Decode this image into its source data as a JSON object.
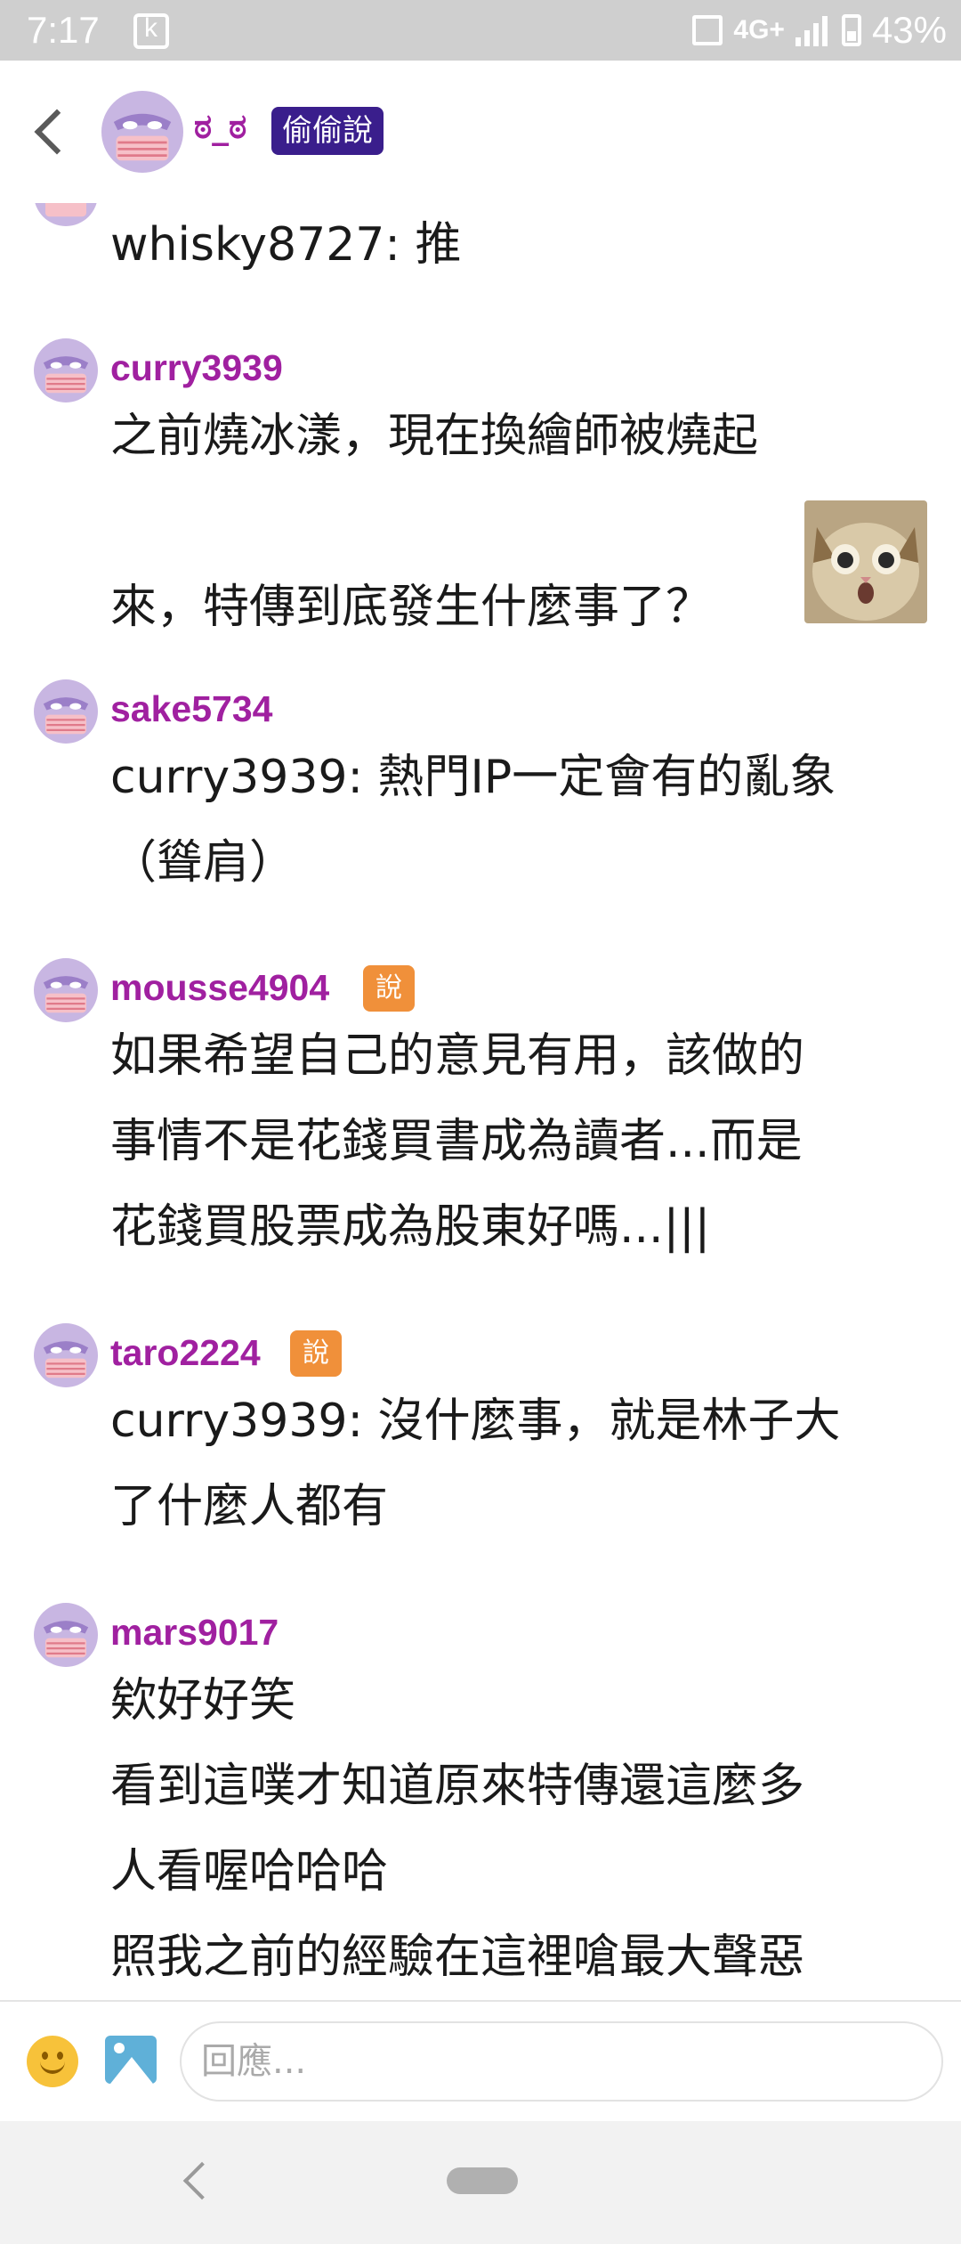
{
  "status_bar": {
    "time": "7:17",
    "network": "4G+",
    "battery": "43%"
  },
  "header": {
    "title": "ಠ_ಠ",
    "badge": "偷偷說"
  },
  "comments": [
    {
      "body": "whisky8727: 推"
    },
    {
      "username": "curry3939",
      "body": "之前燒冰漾，現在換繪師被燒起\n\n來，特傳到底發生什麼事了？"
    },
    {
      "username": "sake5734",
      "body": "curry3939: 熱門IP一定會有的亂象\n（聳肩）"
    },
    {
      "username": "mousse4904",
      "badge": "說",
      "body": "如果希望自己的意見有用，該做的\n事情不是花錢買書成為讀者...而是\n花錢買股票成為股東好嗎...|||"
    },
    {
      "username": "taro2224",
      "badge": "說",
      "body": "curry3939: 沒什麼事，就是林子大\n了什麼人都有"
    },
    {
      "username": "mars9017",
      "body": "欸好好笑\n看到這噗才知道原來特傳還這麼多\n人看喔哈哈哈\n照我之前的經驗在這裡嗆最大聲惡"
    }
  ],
  "reply_bar": {
    "placeholder": "回應..."
  },
  "icons": {
    "back": "chevron-left-icon",
    "emoji": "emoji-icon",
    "image": "image-icon",
    "avatar": "masked-face-avatar"
  },
  "colors": {
    "username": "#a020a0",
    "badge_purple": "#3a1e8c",
    "badge_orange": "#f0903a"
  }
}
